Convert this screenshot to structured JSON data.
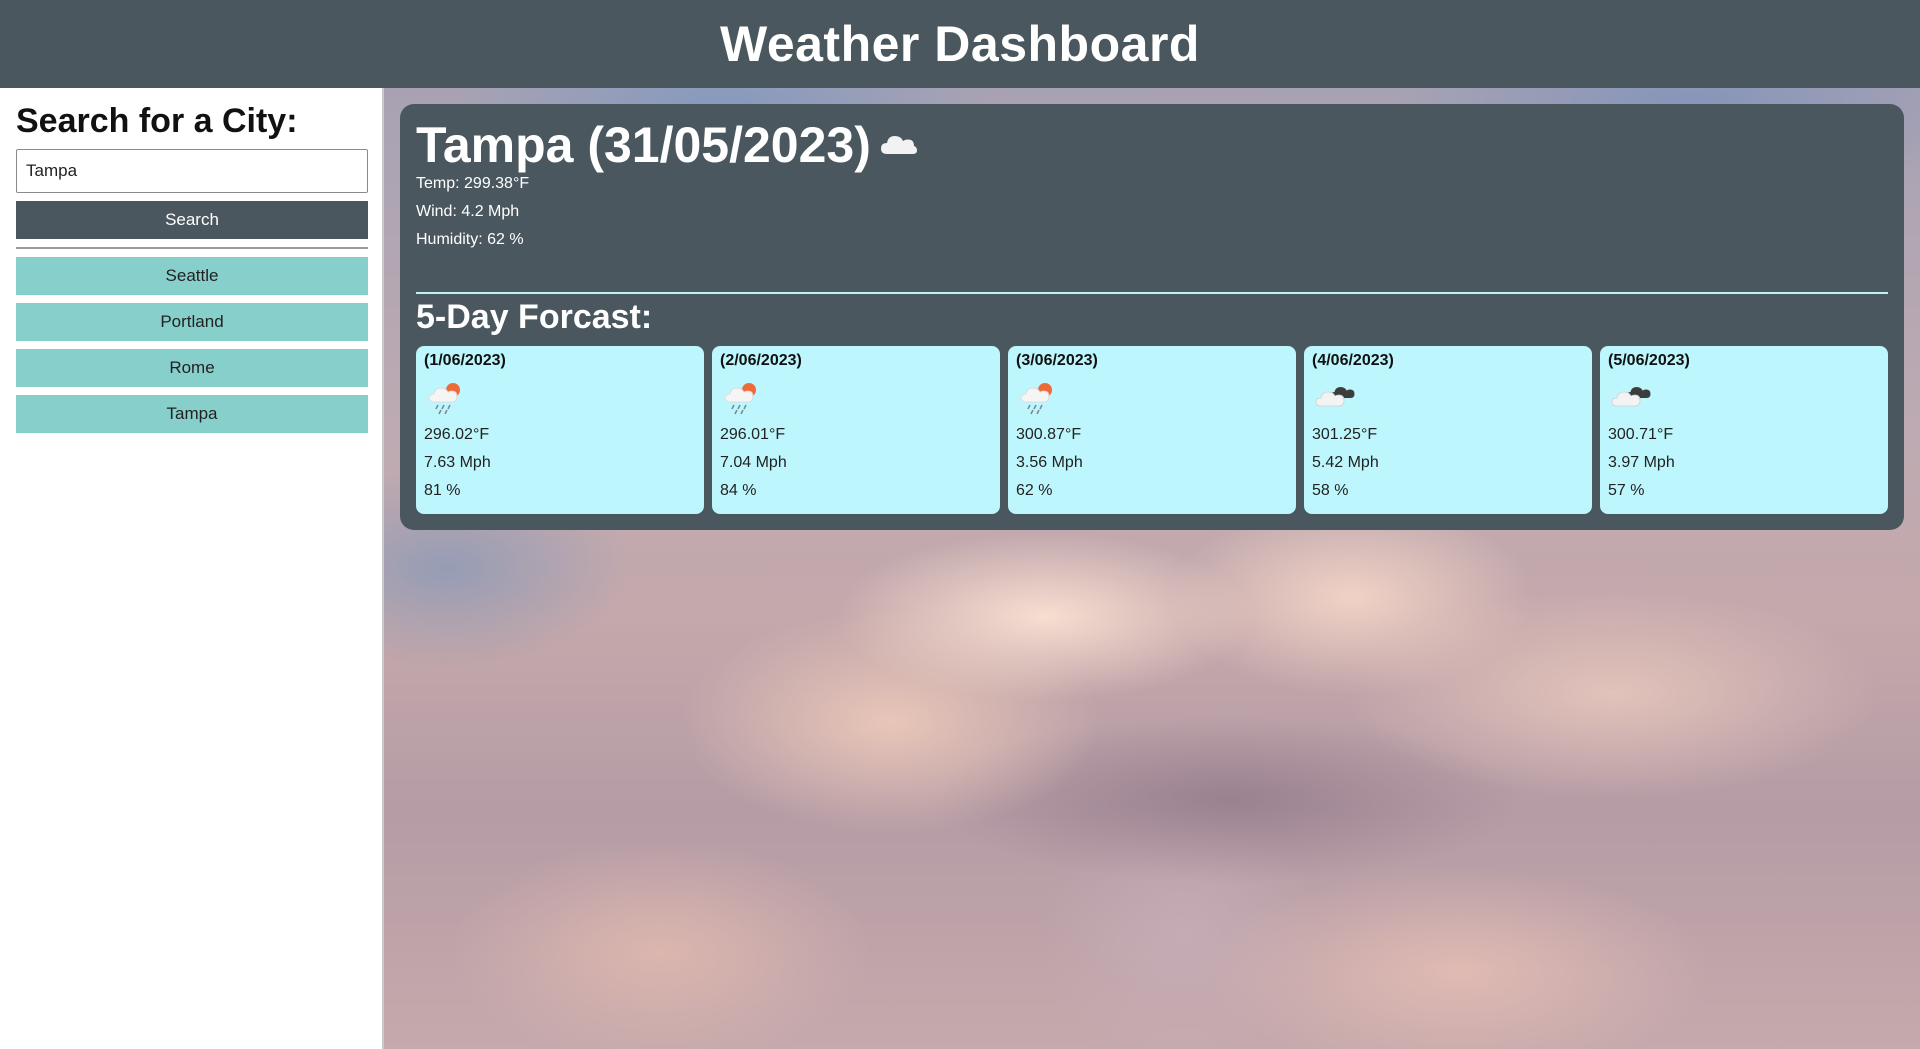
{
  "header": {
    "title": "Weather Dashboard"
  },
  "sidebar": {
    "heading": "Search for a City:",
    "search": {
      "value": "Tampa",
      "placeholder": ""
    },
    "search_button": "Search",
    "history": [
      "Seattle",
      "Portland",
      "Rome",
      "Tampa"
    ]
  },
  "current": {
    "title": "Tampa (31/05/2023)",
    "icon": "cloud-icon",
    "temp": "Temp: 299.38°F",
    "wind": "Wind: 4.2 Mph",
    "humidity": "Humidity: 62 %"
  },
  "forecast": {
    "heading": "5-Day Forcast:",
    "days": [
      {
        "date": "(1/06/2023)",
        "icon": "rain-sun-icon",
        "temp": "296.02°F",
        "wind": "7.63 Mph",
        "humidity": "81 %"
      },
      {
        "date": "(2/06/2023)",
        "icon": "rain-sun-icon",
        "temp": "296.01°F",
        "wind": "7.04 Mph",
        "humidity": "84 %"
      },
      {
        "date": "(3/06/2023)",
        "icon": "rain-sun-icon",
        "temp": "300.87°F",
        "wind": "3.56 Mph",
        "humidity": "62 %"
      },
      {
        "date": "(4/06/2023)",
        "icon": "broken-clouds-icon",
        "temp": "301.25°F",
        "wind": "5.42 Mph",
        "humidity": "58 %"
      },
      {
        "date": "(5/06/2023)",
        "icon": "broken-clouds-icon",
        "temp": "300.71°F",
        "wind": "3.97 Mph",
        "humidity": "57 %"
      }
    ]
  },
  "colors": {
    "header_bg": "#4a575e",
    "panel_bg": "#4a575e",
    "history_button_bg": "#87cfcb",
    "forecast_card_bg": "#bdf7fd"
  }
}
